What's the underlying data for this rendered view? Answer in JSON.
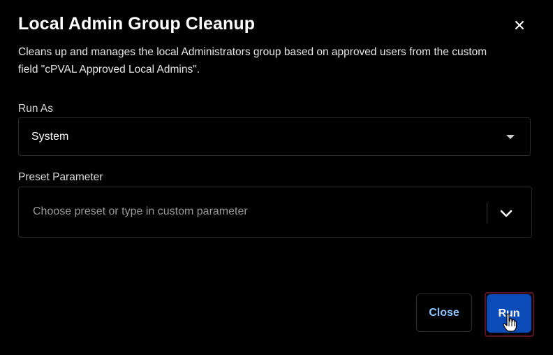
{
  "dialog": {
    "title": "Local Admin Group Cleanup",
    "description": "Cleans up and manages the local Administrators group based on approved users from the custom field \"cPVAL Approved Local Admins\".",
    "close_icon": "close-icon"
  },
  "run_as": {
    "label": "Run As",
    "value": "System",
    "icon": "caret-down-icon"
  },
  "preset_parameter": {
    "label": "Preset Parameter",
    "placeholder": "Choose preset or type in custom parameter",
    "value": "",
    "icon": "chevron-down-icon"
  },
  "footer": {
    "close_label": "Close",
    "run_label": "Run"
  },
  "colors": {
    "background": "#000000",
    "accent": "#0a4bb8",
    "link": "#8ec5ff",
    "border": "#2b2b2b"
  }
}
